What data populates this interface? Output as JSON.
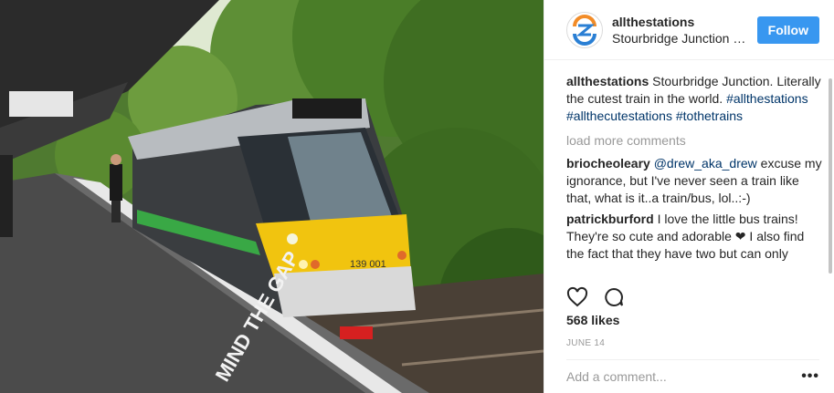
{
  "post": {
    "username": "allthestations",
    "location": "Stourbridge Junction rai...",
    "follow_label": "Follow",
    "caption": {
      "user": "allthestations",
      "text": "Stourbridge Junction. Literally the cutest train in the world.",
      "hashtags": [
        "#allthestations",
        "#allthecutestations",
        "#tothetrains"
      ]
    },
    "load_more": "load more comments",
    "comments": [
      {
        "user": "briocheoleary",
        "mention": "@drew_aka_drew",
        "text": "excuse my ignorance, but I've never seen a train like that, what is it..a train/bus, lol..:-)"
      },
      {
        "user": "patrickburford",
        "text": "I love the little bus trains! They're so cute and adorable ❤ I also find the fact that they have two but can only"
      }
    ],
    "likes": "568 likes",
    "date": "JUNE 14",
    "add_comment_placeholder": "Add a comment...",
    "more_label": "•••"
  },
  "photo": {
    "train_number": "139 001",
    "platform_text": "MIND THE GAP"
  },
  "icons": [
    "heart-icon",
    "comment-icon",
    "avatar-logo"
  ],
  "colors": {
    "follow": "#3897f0",
    "link": "#003569",
    "muted": "#999999",
    "train_yellow": "#f1c40f"
  }
}
